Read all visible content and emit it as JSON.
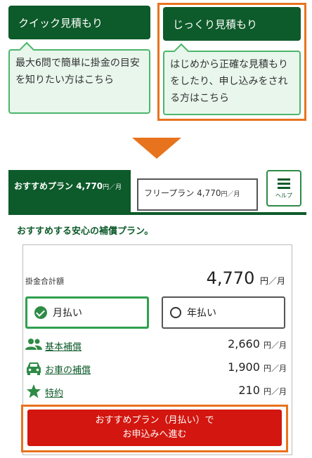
{
  "quote_options": {
    "quick": {
      "label": "クイック見積もり",
      "description": "最大6問で簡単に掛金の目安を知りたい方はこちら"
    },
    "careful": {
      "label": "じっくり見積もり",
      "description": "はじめから正確な見積もりをしたり、申し込みをされる方はこちら"
    }
  },
  "plans": {
    "recommended_tab": {
      "name": "おすすめプラン",
      "price": "4,770",
      "unit": "円／月"
    },
    "free_tab": {
      "name": "フリープラン",
      "price": "4,770",
      "unit": "円／月"
    },
    "help_label": "ヘルプ"
  },
  "recommended_heading": "おすすめする安心の補償プラン。",
  "summary": {
    "total_label": "掛金合計額",
    "total_value": "4,770",
    "total_unit": "円／月"
  },
  "payment": {
    "monthly_label": "月払い",
    "yearly_label": "年払い",
    "selected": "月払い"
  },
  "coverages": [
    {
      "icon": "people-icon",
      "name": "基本補償",
      "amount": "2,660",
      "unit": "円／月"
    },
    {
      "icon": "car-icon",
      "name": "お車の補償",
      "amount": "1,900",
      "unit": "円／月"
    },
    {
      "icon": "star-icon",
      "name": "特約",
      "amount": "210",
      "unit": "円／月"
    }
  ],
  "cta": {
    "line1": "おすすめプラン（月払い）で",
    "line2": "お申込みへ進む"
  },
  "colors": {
    "primary_green": "#0d5a2a",
    "accent_orange": "#e8731e",
    "cta_red": "#d3160f",
    "light_green": "#e8f6ec"
  }
}
